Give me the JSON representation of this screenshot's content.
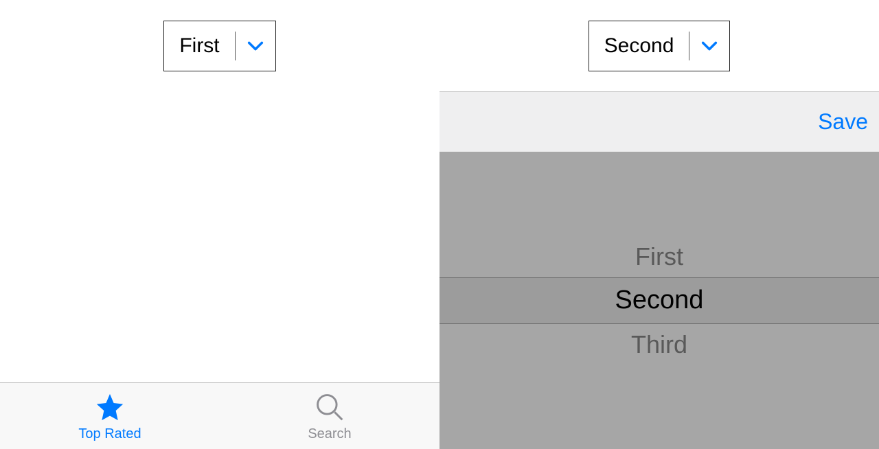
{
  "left": {
    "dropdown": {
      "selected": "First"
    },
    "tabs": [
      {
        "label": "Top Rated",
        "active": true
      },
      {
        "label": "Search",
        "active": false
      }
    ]
  },
  "right": {
    "dropdown": {
      "selected": "Second"
    },
    "toolbar": {
      "save_label": "Save"
    },
    "picker": {
      "options": [
        "First",
        "Second",
        "Third"
      ],
      "selected_index": 1
    }
  }
}
